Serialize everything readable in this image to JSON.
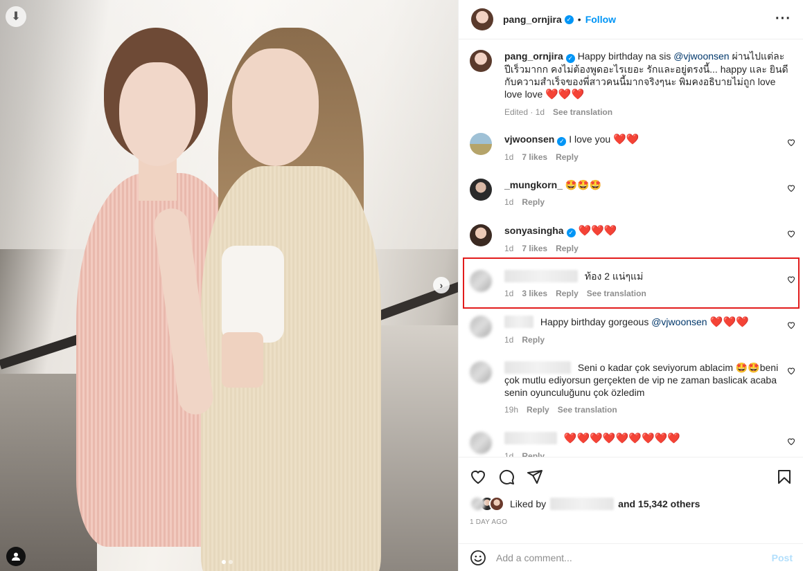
{
  "post": {
    "username": "pang_ornjira",
    "follow_label": "Follow",
    "separator": "•",
    "more_icon": "more-horizontal-icon"
  },
  "caption": {
    "username": "pang_ornjira",
    "text_1": "Happy birthday na sis ",
    "mention": "@vjwoonsen",
    "text_2": " ผ่านไปแต่ละปีเร็วมากก คงไม่ต้องพูดอะไรเยอะ รักและอยู่ตรงนี้... happy และ ยินดีกับความสำเร็จของพี่สาวคนนี้มากจริงๆนะ พิมคงอธิบายไม่ถูก love love love ",
    "hearts": "❤️❤️❤️",
    "edited": "Edited · 1d",
    "see_translation": "See translation"
  },
  "comments": [
    {
      "username": "vjwoonsen",
      "verified": true,
      "text": "I love you ",
      "hearts": "❤️❤️",
      "time": "1d",
      "likes": "7 likes",
      "reply": "Reply"
    },
    {
      "username": "_mungkorn_",
      "verified": false,
      "text": "🤩🤩🤩",
      "time": "1d",
      "reply": "Reply"
    },
    {
      "username": "sonyasingha",
      "verified": true,
      "hearts": "❤️❤️❤️",
      "time": "1d",
      "likes": "7 likes",
      "reply": "Reply"
    },
    {
      "text": "ท้อง 2 แน่ๆแม่",
      "time": "1d",
      "likes": "3 likes",
      "reply": "Reply",
      "see_translation": "See translation"
    },
    {
      "text": "Happy birthday gorgeous ",
      "mention": "@vjwoonsen",
      "hearts": " ❤️❤️❤️",
      "time": "1d",
      "reply": "Reply"
    },
    {
      "text": "Seni o kadar çok seviyorum ablacim 🤩🤩beni çok mutlu ediyorsun gerçekten de vip ne zaman baslicak acaba senin oyunculuğunu çok özledim",
      "time": "19h",
      "reply": "Reply",
      "see_translation": "See translation"
    },
    {
      "hearts": "❤️❤️❤️❤️❤️❤️❤️❤️❤️",
      "time": "1d",
      "reply": "Reply"
    }
  ],
  "likes": {
    "liked_by": "Liked by",
    "and_others": "and 15,342 others",
    "timestamp": "1 DAY AGO"
  },
  "composer": {
    "placeholder": "Add a comment...",
    "post_label": "Post"
  },
  "icons": [
    "download-icon",
    "chevron-right-icon",
    "user-tag-icon",
    "verified-icon",
    "heart-icon",
    "comment-icon",
    "share-icon",
    "bookmark-icon",
    "emoji-icon"
  ]
}
